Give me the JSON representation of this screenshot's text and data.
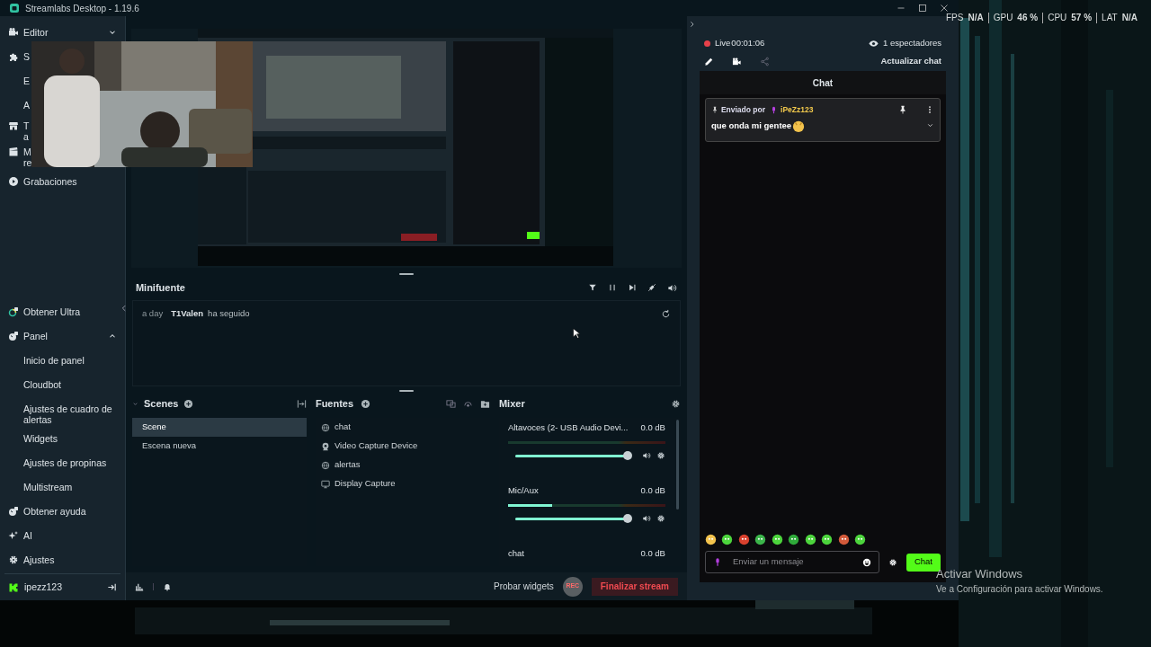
{
  "window": {
    "title": "Streamlabs Desktop - 1.19.6"
  },
  "overlay_stats": [
    {
      "label": "FPS",
      "value": "N/A"
    },
    {
      "label": "GPU",
      "value": "46 %"
    },
    {
      "label": "CPU",
      "value": "57 %"
    },
    {
      "label": "LAT",
      "value": "N/A"
    }
  ],
  "sidebar": {
    "top_items": [
      {
        "label": "Editor",
        "expanded": false
      },
      {
        "label": "S"
      },
      {
        "label": "E"
      },
      {
        "label": "A"
      },
      {
        "label": "T",
        "label_line2": "a"
      },
      {
        "label": "M",
        "label_line2": "re"
      },
      {
        "label": "Grabaciones"
      }
    ],
    "bottom_items": [
      {
        "label": "Obtener Ultra"
      },
      {
        "label": "Panel",
        "expanded": true,
        "children": [
          {
            "label": "Inicio de panel"
          },
          {
            "label": "Cloudbot"
          },
          {
            "label": "Ajustes de cuadro de alertas"
          },
          {
            "label": "Widgets"
          },
          {
            "label": "Ajustes de propinas"
          },
          {
            "label": "Multistream"
          }
        ]
      },
      {
        "label": "Obtener ayuda"
      },
      {
        "label": "AI"
      },
      {
        "label": "Ajustes"
      }
    ],
    "user": {
      "name": "ipezz123"
    }
  },
  "minifeed": {
    "title": "Minifuente",
    "events": [
      {
        "time": "a day",
        "user": "T1Valen",
        "action": "ha seguido"
      }
    ]
  },
  "scenes": {
    "title": "Scenes",
    "items": [
      {
        "label": "Scene",
        "selected": true
      },
      {
        "label": "Escena nueva",
        "selected": false
      }
    ]
  },
  "sources": {
    "title": "Fuentes",
    "items": [
      {
        "label": "chat",
        "kind": "browser"
      },
      {
        "label": "Video Capture Device",
        "kind": "webcam"
      },
      {
        "label": "alertas",
        "kind": "browser"
      },
      {
        "label": "Display Capture",
        "kind": "display"
      }
    ]
  },
  "mixer": {
    "title": "Mixer",
    "channels": [
      {
        "name": "Altavoces (2- USB Audio Devi...",
        "reading": "0.0 dB",
        "volume": {
          "level": 1
        }
      },
      {
        "name": "Mic/Aux",
        "reading": "0.0 dB",
        "meter": {
          "level": 0.28
        },
        "volume": {
          "level": 1
        }
      },
      {
        "name": "chat",
        "reading": "0.0 dB"
      }
    ]
  },
  "footer": {
    "test_widgets": "Probar widgets",
    "rec": "REC",
    "end_stream": "Finalizar stream"
  },
  "chat_panel": {
    "live": "Live",
    "time": "00:01:06",
    "viewers": "1 espectadores",
    "refresh": "Actualizar chat",
    "header": "Chat",
    "pinned": {
      "prefix": "Enviado por",
      "user": "iPeZz123",
      "message": "que onda mi gentee"
    },
    "input_placeholder": "Enviar un mensaje",
    "send": "Chat"
  },
  "windows_activation": {
    "title": "Activar Windows",
    "subtitle": "Ve a Configuración para activar Windows."
  }
}
